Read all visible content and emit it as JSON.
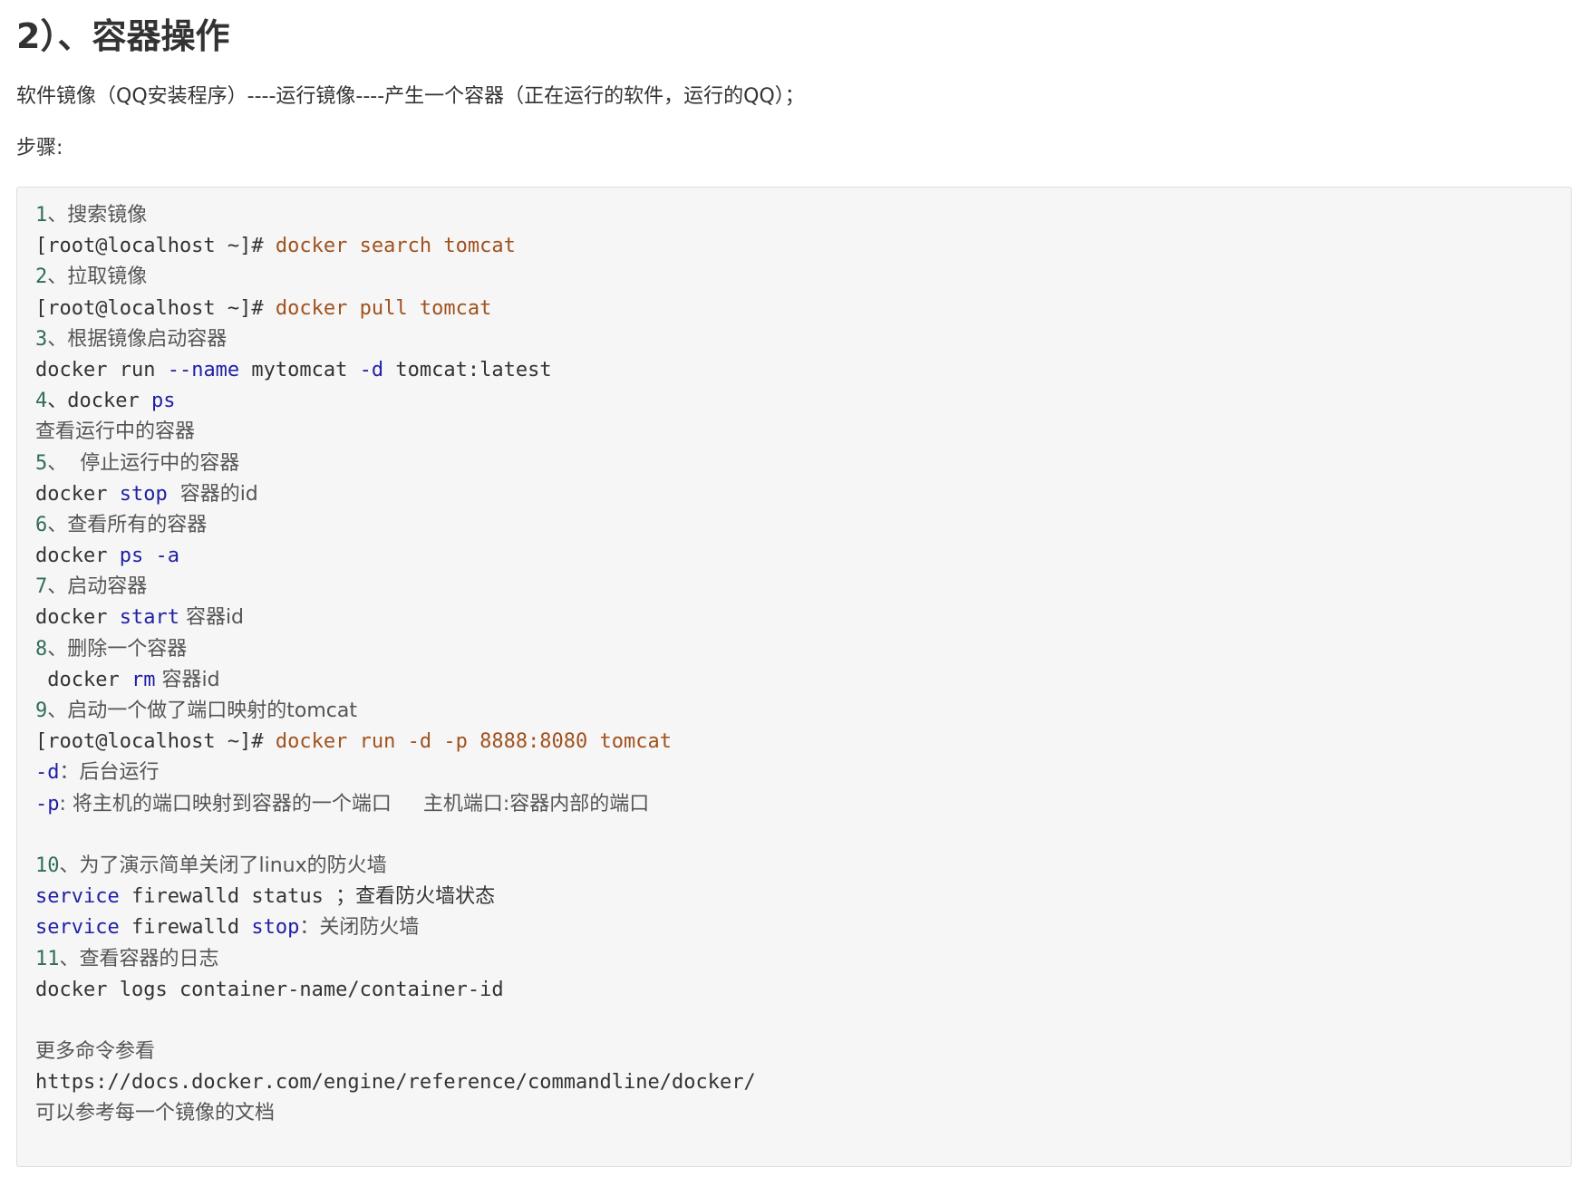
{
  "heading": "2）、容器操作",
  "intro": "软件镜像（QQ安装程序）----运行镜像----产生一个容器（正在运行的软件，运行的QQ）；",
  "steps_label": "步骤:",
  "code": {
    "l1_num": "1",
    "l1_text": "、搜索镜像",
    "l2_prompt": "[root@localhost ~]#",
    "l2_cmd": " docker search tomcat",
    "l3_num": "2",
    "l3_text": "、拉取镜像",
    "l4_prompt": "[root@localhost ~]#",
    "l4_cmd": " docker pull tomcat",
    "l5_num": "3",
    "l5_text": "、根据镜像启动容器",
    "l6_a": "docker run ",
    "l6_b": "--name",
    "l6_c": " mytomcat ",
    "l6_d": "-d",
    "l6_e": " tomcat:latest",
    "l7_num": "4",
    "l7_a": "、docker ",
    "l7_b": "ps",
    "l8_text": "查看运行中的容器",
    "l9_num": "5",
    "l9_text": "、  停止运行中的容器",
    "l10_a": "docker ",
    "l10_b": "stop",
    "l10_c": "  容器的id",
    "l11_num": "6",
    "l11_text": "、查看所有的容器",
    "l12_a": "docker ",
    "l12_b": "ps -a",
    "l13_num": "7",
    "l13_text": "、启动容器",
    "l14_a": "docker ",
    "l14_b": "start",
    "l14_c": " 容器id",
    "l15_num": "8",
    "l15_text": "、删除一个容器",
    "l16_a": " docker ",
    "l16_b": "rm",
    "l16_c": " 容器id",
    "l17_num": "9",
    "l17_text": "、启动一个做了端口映射的tomcat",
    "l18_prompt": "[root@localhost ~]#",
    "l18_cmd": " docker run -d -p 8888:8080 tomcat",
    "l19_a": "-d",
    "l19_b": "：后台运行",
    "l20_a": "-p",
    "l20_b": ": 将主机的端口映射到容器的一个端口     主机端口:容器内部的端口",
    "l21_blank": "",
    "l22_num": "10",
    "l22_text": "、为了演示简单关闭了linux的防火墙",
    "l23_a": "service",
    "l23_b": " firewalld status ；查看防火墙状态",
    "l24_a": "service",
    "l24_b": " firewalld ",
    "l24_c": "stop",
    "l24_d": "：关闭防火墙",
    "l25_num": "11",
    "l25_text": "、查看容器的日志",
    "l26_text": "docker logs container-name/container-id",
    "l27_blank": "",
    "l28_text": "更多命令参看",
    "l29_text": "https://docs.docker.com/engine/reference/commandline/docker/",
    "l30_text": "可以参考每一个镜像的文档"
  },
  "colors": {
    "number": "#2f6d5a",
    "command": "#a0521e",
    "keyword": "#1f1fa6",
    "code_bg": "#f6f6f6"
  }
}
